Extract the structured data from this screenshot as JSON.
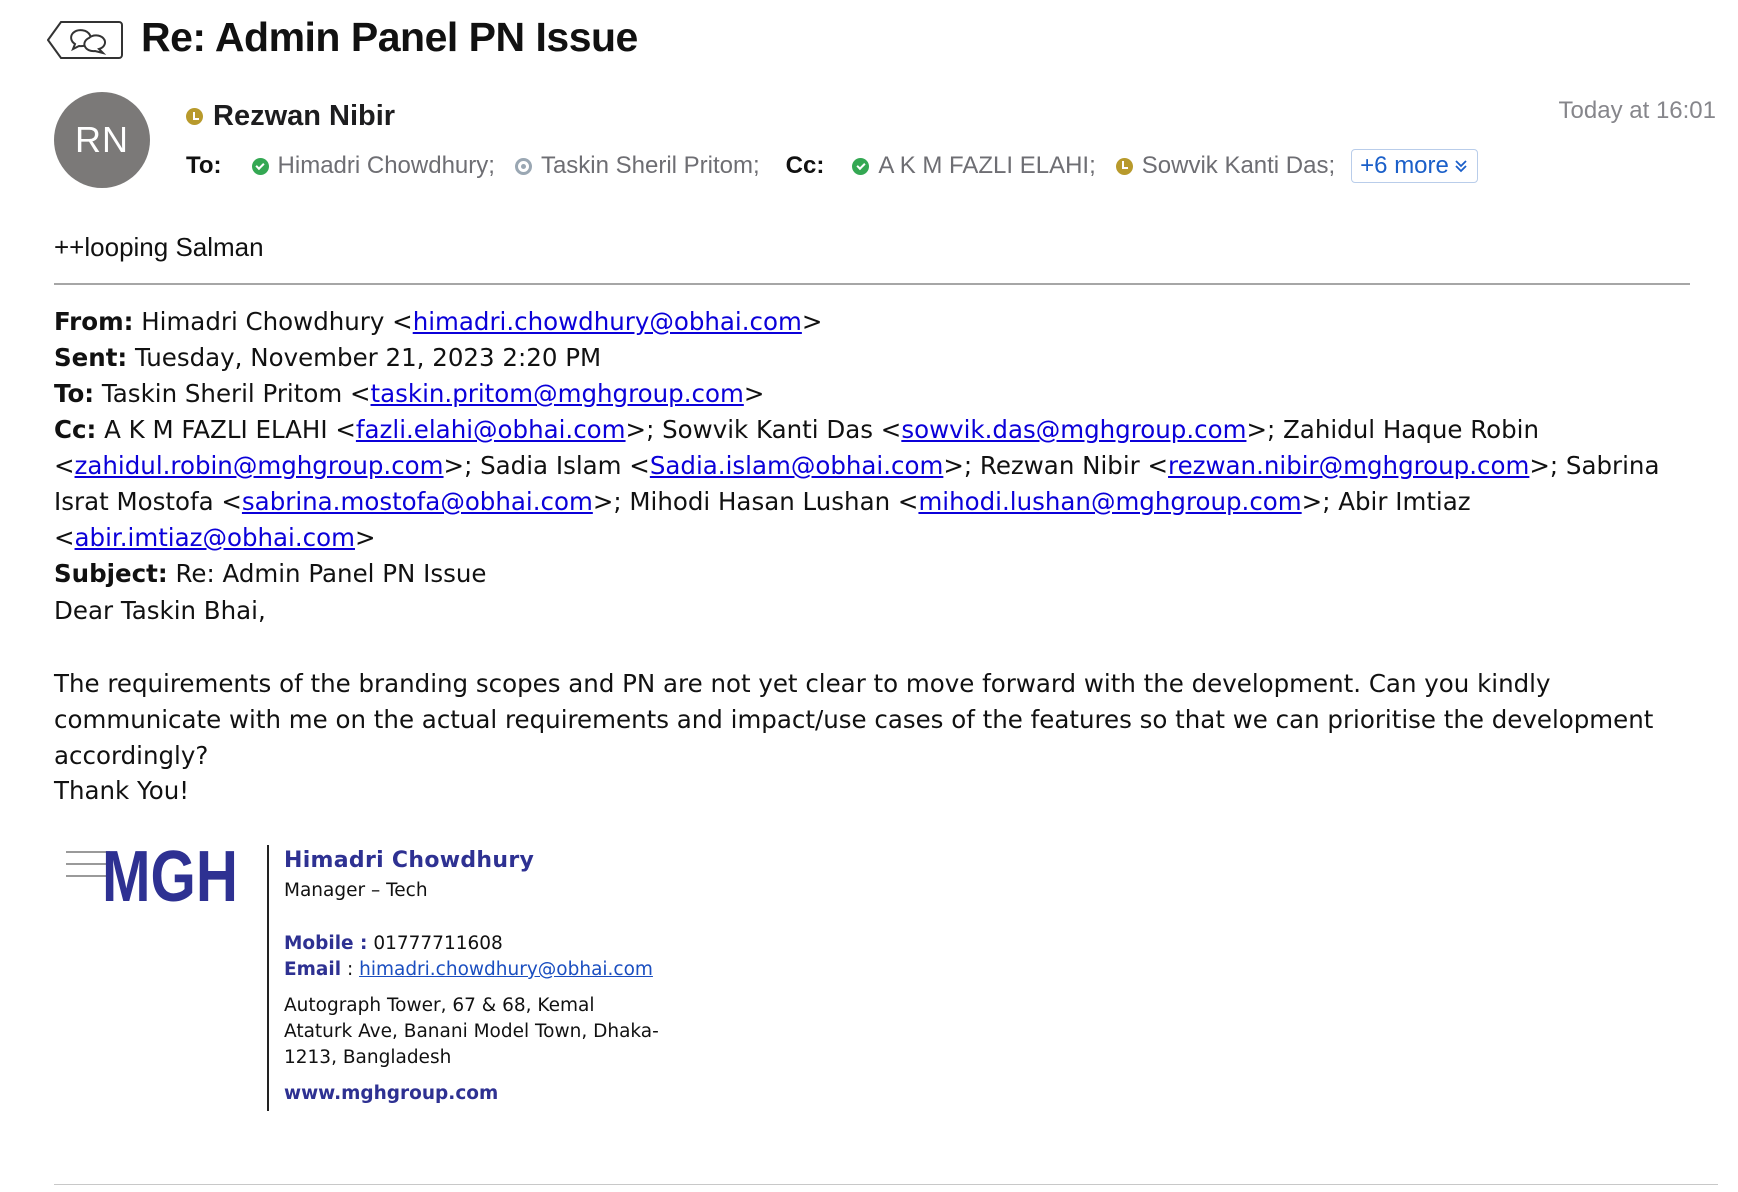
{
  "header": {
    "subject": "Re: Admin Panel PN Issue",
    "timestamp": "Today at 16:01"
  },
  "sender": {
    "initials": "RN",
    "name": "Rezwan Nibir",
    "status": "away"
  },
  "recipients": {
    "to_label": "To:",
    "to": [
      {
        "name": "Himadri Chowdhury;",
        "status": "available"
      },
      {
        "name": "Taskin Sheril Pritom;",
        "status": "offline"
      }
    ],
    "cc_label": "Cc:",
    "cc": [
      {
        "name": "A K M FAZLI ELAHI;",
        "status": "available"
      },
      {
        "name": "Sowvik Kanti Das;",
        "status": "away"
      }
    ],
    "more_label": "+6 more"
  },
  "body": {
    "looping": "++looping Salman",
    "quoted": {
      "from_label": "From:",
      "from_name": " Himadri Chowdhury <",
      "from_email": "himadri.chowdhury@obhai.com",
      "sent_label": "Sent:",
      "sent_value": " Tuesday, November 21, 2023 2:20 PM",
      "to_label": "To:",
      "to_name": " Taskin Sheril Pritom <",
      "to_email": "taskin.pritom@mghgroup.com",
      "cc_label": "Cc:",
      "cc_1_name": " A K M FAZLI ELAHI <",
      "cc_1_email": "fazli.elahi@obhai.com",
      "cc_2_name": ">; Sowvik Kanti Das <",
      "cc_2_email": "sowvik.das@mghgroup.com",
      "cc_3_name": ">; Zahidul Haque Robin <",
      "cc_3_email": "zahidul.robin@mghgroup.com",
      "cc_4_name": ">; Sadia Islam <",
      "cc_4_email": "Sadia.islam@obhai.com",
      "cc_5_name": ">; Rezwan Nibir <",
      "cc_5_email": "rezwan.nibir@mghgroup.com",
      "cc_6_name": ">; Sabrina Israt Mostofa <",
      "cc_6_email": "sabrina.mostofa@obhai.com",
      "cc_7_name": ">; Mihodi Hasan Lushan <",
      "cc_7_email": "mihodi.lushan@mghgroup.com",
      "cc_8_name": ">; Abir Imtiaz <",
      "cc_8_email": "abir.imtiaz@obhai.com",
      "cc_end": ">",
      "subject_label": "Subject:",
      "subject_value": " Re: Admin Panel PN Issue"
    },
    "greeting": "Dear Taskin Bhai,",
    "paragraph": "The requirements of the branding scopes and PN are not yet clear to move forward with the development. Can you kindly communicate with me on the actual requirements and impact/use cases of the features so that we can prioritise the development accordingly?",
    "closing": "Thank You!"
  },
  "signature": {
    "logo_text": "MGH",
    "name": "Himadri Chowdhury",
    "title": "Manager – Tech",
    "mobile_label": "Mobile :",
    "mobile": " 01777711608",
    "email_label": "Email",
    "email_sep": " : ",
    "email": "himadri.chowdhury@obhai.com",
    "address": "Autograph Tower, 67 & 68, Kemal Ataturk Ave, Banani Model Town, Dhaka-1213, Bangladesh",
    "website": "www.mghgroup.com",
    "brand_color": "#2e3192"
  },
  "colors": {
    "link": "#0b00d9",
    "status_available": "#34a853",
    "status_away": "#b89a2c",
    "status_offline": "#9aa7b3",
    "avatar_bg": "#7b7978"
  }
}
